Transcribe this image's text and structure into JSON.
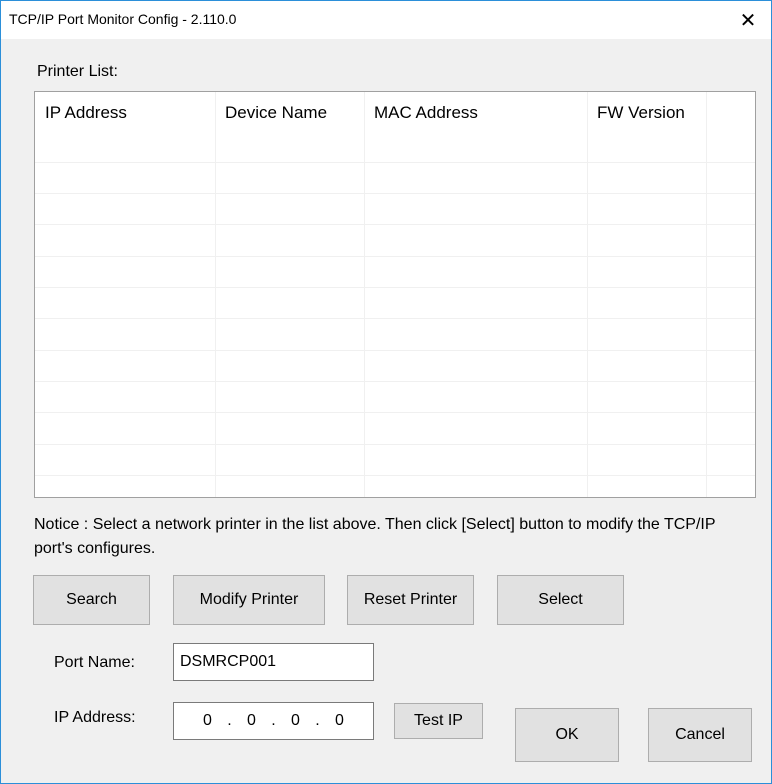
{
  "window": {
    "title": "TCP/IP Port Monitor Config - 2.110.0",
    "close_glyph": "✕"
  },
  "printer_list": {
    "label": "Printer List:",
    "columns": [
      "IP Address",
      "Device Name",
      "MAC Address",
      "FW Version"
    ],
    "rows": []
  },
  "notice": "Notice : Select a network printer in the list above. Then click [Select] button to modify the TCP/IP port's configures.",
  "buttons": {
    "search": "Search",
    "modify_printer": "Modify Printer",
    "reset_printer": "Reset Printer",
    "select": "Select",
    "test_ip": "Test IP",
    "ok": "OK",
    "cancel": "Cancel"
  },
  "port": {
    "label": "Port Name:",
    "value": "DSMRCP001"
  },
  "ip": {
    "label": "IP Address:",
    "octets": [
      "0",
      "0",
      "0",
      "0"
    ],
    "separator": "."
  },
  "icons": {
    "close": "close-icon"
  }
}
